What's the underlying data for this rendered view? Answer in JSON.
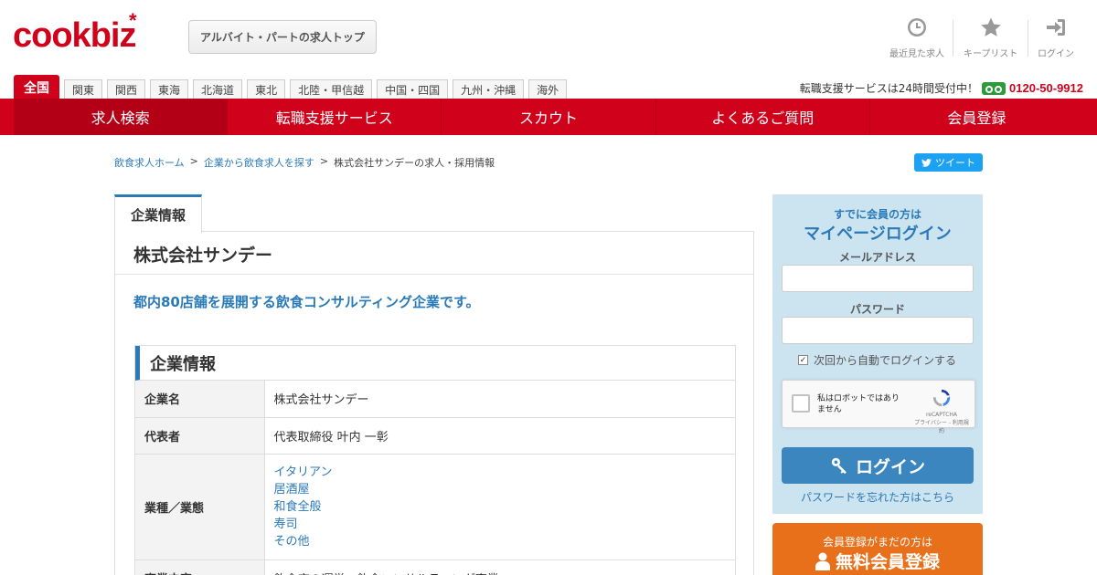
{
  "header": {
    "logo_text": "cookbiz",
    "logo_mark": "*",
    "top_button": "アルバイト・パートの求人トップ",
    "utils": [
      {
        "icon": "clock-icon",
        "label": "最近見た求人"
      },
      {
        "icon": "star-icon",
        "label": "キープリスト"
      },
      {
        "icon": "login-icon",
        "label": "ログイン"
      }
    ]
  },
  "regions": [
    "全国",
    "関東",
    "関西",
    "東海",
    "北海道",
    "東北",
    "北陸・甲信越",
    "中国・四国",
    "九州・沖縄",
    "海外"
  ],
  "support": {
    "text": "転職支援サービスは24時間受付中！",
    "icon": "freedial-icon",
    "tel": "0120-50-9912"
  },
  "nav": [
    "求人検索",
    "転職支援サービス",
    "スカウト",
    "よくあるご質問",
    "会員登録"
  ],
  "breadcrumb": {
    "home": "飲食求人ホーム",
    "list": "企業から飲食求人を探す",
    "current": "株式会社サンデーの求人・採用情報",
    "sep": ">"
  },
  "tweet": "ツイート",
  "company": {
    "tab": "企業情報",
    "name": "株式会社サンデー",
    "lead": "都内80店舗を展開する飲食コンサルティング企業です。",
    "section_title": "企業情報",
    "rows": {
      "name_label": "企業名",
      "name_value": "株式会社サンデー",
      "rep_label": "代表者",
      "rep_value": "代表取締役 叶内 一彰",
      "type_label": "業種／業態",
      "types": [
        "イタリアン",
        "居酒屋",
        "和食全般",
        "寿司",
        "その他"
      ],
      "biz_label": "事業内容",
      "biz_value": "飲食店の運営・飲食コンサルティング事業"
    }
  },
  "login": {
    "sub": "すでに会員の方は",
    "title": "マイページログイン",
    "email_label": "メールアドレス",
    "password_label": "パスワード",
    "remember": "次回から自動でログインする",
    "remember_checked": true,
    "captcha_text": "私はロボットではありません",
    "captcha_brand": "reCAPTCHA",
    "captcha_links": "プライバシー - 利用規約",
    "button": "ログイン",
    "forgot": "パスワードを忘れた方はこちら"
  },
  "signup": {
    "sub": "会員登録がまだの方は",
    "main": "無料会員登録"
  },
  "colors": {
    "brand": "#d0021b",
    "link": "#2a7ab8",
    "login_bg": "#cce3f0",
    "signup": "#e8701a"
  }
}
